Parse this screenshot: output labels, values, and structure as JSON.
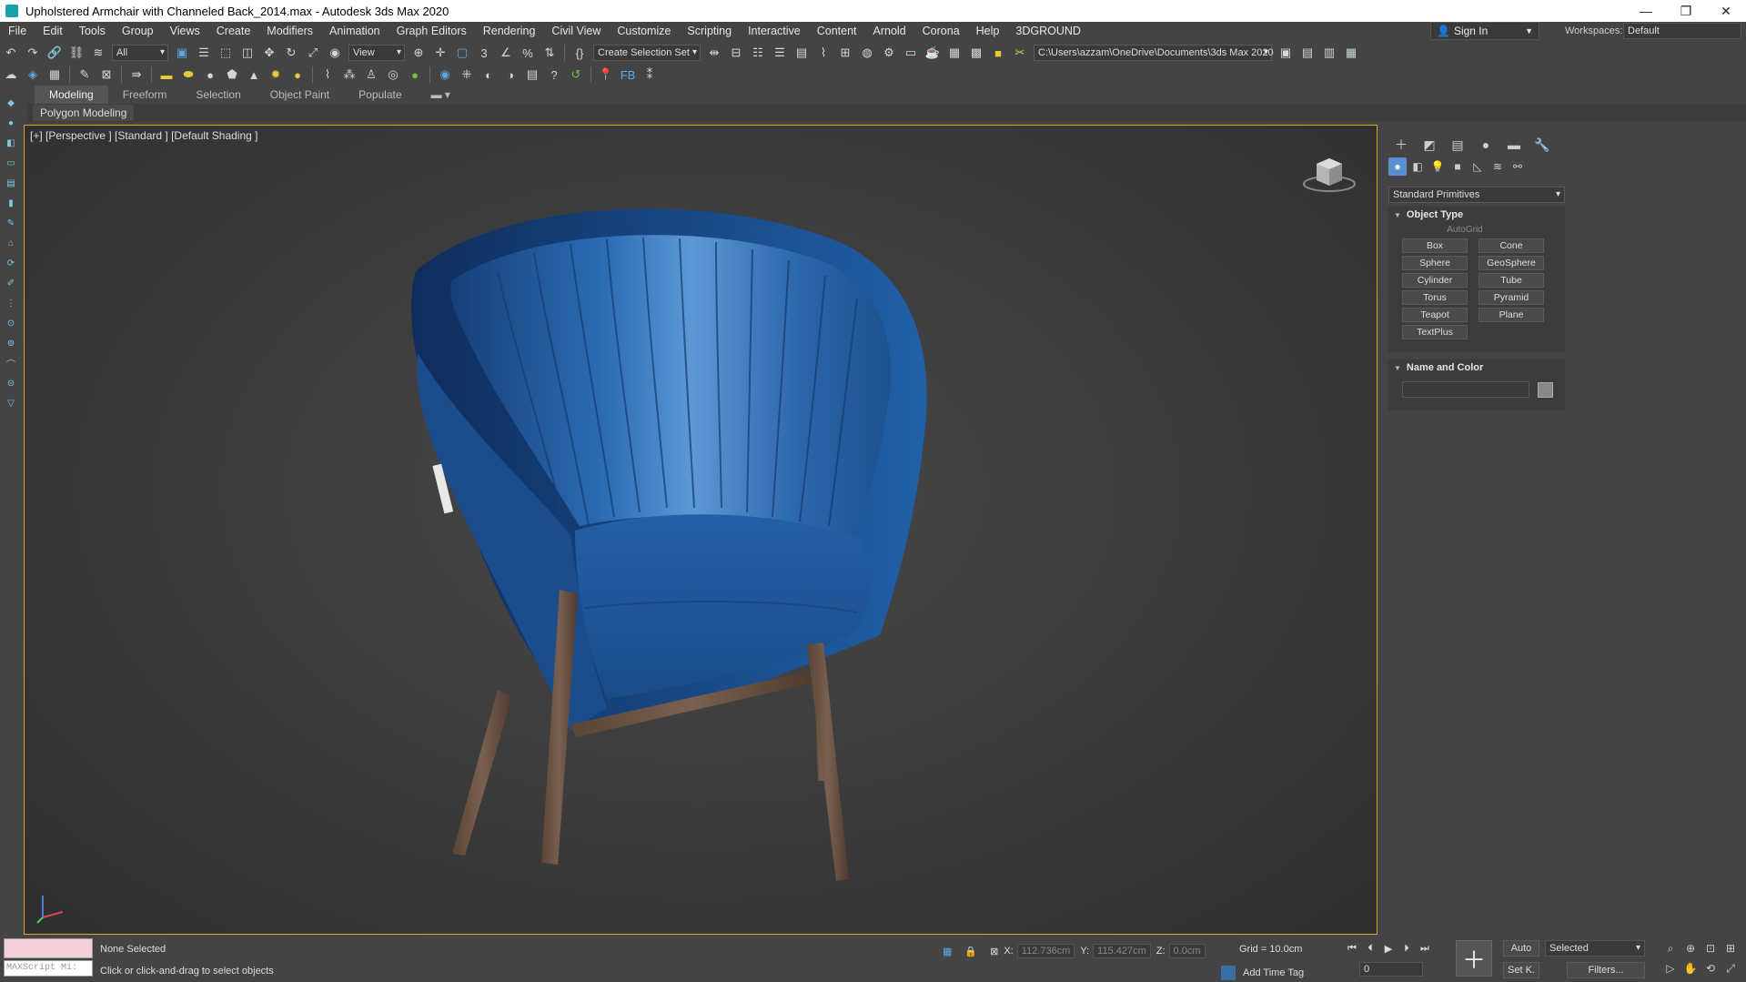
{
  "window": {
    "title": "Upholstered Armchair with Channeled Back_2014.max - Autodesk 3ds Max 2020",
    "controls": [
      "—",
      "❐",
      "✕"
    ]
  },
  "menu": [
    "File",
    "Edit",
    "Tools",
    "Group",
    "Views",
    "Create",
    "Modifiers",
    "Animation",
    "Graph Editors",
    "Rendering",
    "Civil View",
    "Customize",
    "Scripting",
    "Interactive",
    "Content",
    "Arnold",
    "Corona",
    "Help",
    "3DGROUND"
  ],
  "account": {
    "signin": "Sign In",
    "workspaces_label": "Workspaces:",
    "workspace": "Default"
  },
  "toolbar": {
    "filter": "All",
    "ref_coord": "View",
    "selection_set": "Create Selection Set",
    "project_path": "C:\\Users\\azzam\\OneDrive\\Documents\\3ds Max 2020"
  },
  "ribbon": {
    "tabs": [
      "Modeling",
      "Freeform",
      "Selection",
      "Object Paint",
      "Populate"
    ],
    "panel": "Polygon Modeling"
  },
  "viewport": {
    "label": "[+] [Perspective ] [Standard ] [Default Shading ]",
    "colors": {
      "fabric": "#1f5ea8",
      "fabric_light": "#4a8ad0",
      "wood": "#6b5040",
      "border": "#e0a030"
    }
  },
  "command_panel": {
    "category": "Standard Primitives",
    "object_type_title": "Object Type",
    "autogrid": "AutoGrid",
    "buttons": [
      "Box",
      "Cone",
      "Sphere",
      "GeoSphere",
      "Cylinder",
      "Tube",
      "Torus",
      "Pyramid",
      "Teapot",
      "Plane",
      "TextPlus"
    ],
    "name_color_title": "Name and Color"
  },
  "status": {
    "maxscript": "MAXScript Mi:",
    "selection": "None Selected",
    "prompt": "Click or click-and-drag to select objects",
    "x_label": "X:",
    "x": "112.736cm",
    "y_label": "Y:",
    "y": "115.427cm",
    "z_label": "Z:",
    "z": "0.0cm",
    "grid": "Grid = 10.0cm",
    "add_time_tag": "Add Time Tag",
    "frame": "0",
    "auto": "Auto",
    "setkey": "Set K.",
    "selected": "Selected",
    "filters": "Filters..."
  }
}
